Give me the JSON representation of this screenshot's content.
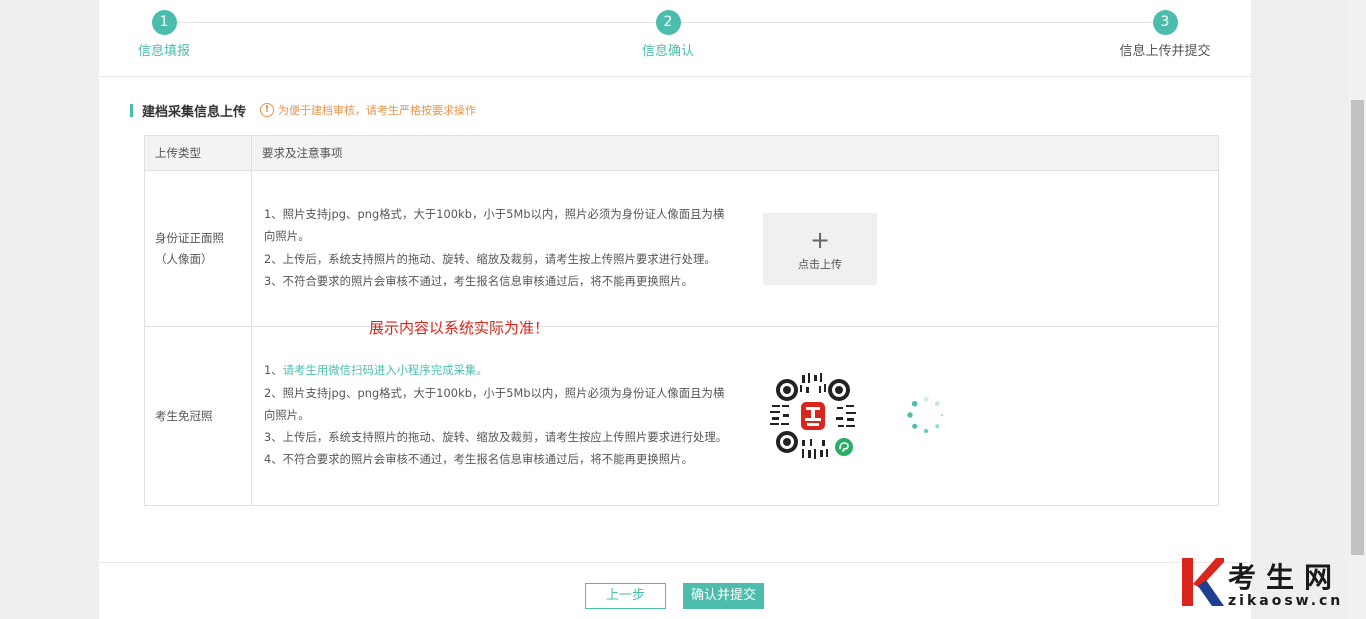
{
  "steps": [
    {
      "num": "1",
      "label": "信息填报"
    },
    {
      "num": "2",
      "label": "信息确认"
    },
    {
      "num": "3",
      "label": "信息上传并提交"
    }
  ],
  "section": {
    "title": "建档采集信息上传",
    "warning_icon": "!",
    "warning": "为便于建档审核，请考生严格按要求操作"
  },
  "table": {
    "headers": [
      "上传类型",
      "要求及注意事项"
    ],
    "rows": [
      {
        "type_line1": "身份证正面照",
        "type_line2": "（人像面）",
        "lines": [
          "1、照片支持jpg、png格式，大于100kb，小于5Mb以内，照片必须为身份证人像面且为横向照片。",
          "2、上传后，系统支持照片的拖动、旋转、缩放及裁剪，请考生按上传照片要求进行处理。",
          "3、不符合要求的照片会审核不通过，考生报名信息审核通过后，将不能再更换照片。"
        ],
        "upload_icon": "+",
        "upload_label": "点击上传"
      },
      {
        "type_line1": "考生免冠照",
        "line1_prefix": "1、",
        "line1_link": "请考生用微信扫码进入小程序完成采集。",
        "lines": [
          "2、照片支持jpg、png格式，大于100kb，小于5Mb以内，照片必须为身份证人像面且为横向照片。",
          "3、上传后，系统支持照片的拖动、旋转、缩放及裁剪，请考生按应上传照片要求进行处理。",
          "4、不符合要求的照片会审核不通过，考生报名信息审核通过后，将不能再更换照片。"
        ]
      }
    ]
  },
  "overlay_note": "展示内容以系统实际为准！",
  "buttons": {
    "prev": "上一步",
    "submit": "确认并提交"
  },
  "logo": {
    "title": "考生网",
    "url": "zikaosw.cn"
  },
  "colors": {
    "accent": "#4cbdad",
    "warning": "#e8944a",
    "note_red": "#d9261c"
  }
}
